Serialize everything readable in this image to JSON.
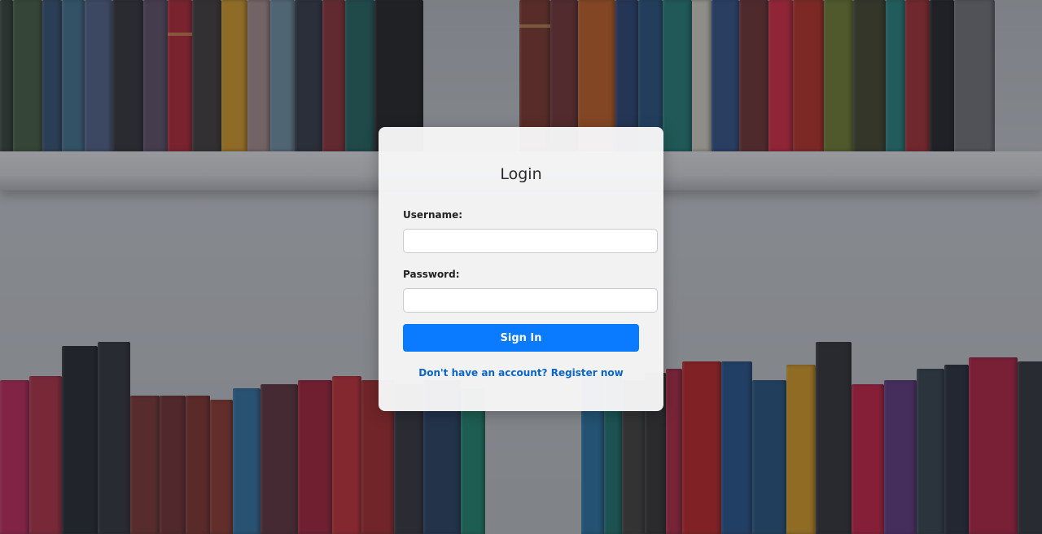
{
  "login": {
    "title": "Login",
    "username_label": "Username:",
    "username_value": "",
    "password_label": "Password:",
    "password_value": "",
    "sign_in_label": "Sign In",
    "register_link": "Don't have an account? Register now"
  },
  "colors": {
    "accent": "#0a7bff",
    "link": "#0a66c8",
    "card_bg": "#f6f6f7"
  }
}
